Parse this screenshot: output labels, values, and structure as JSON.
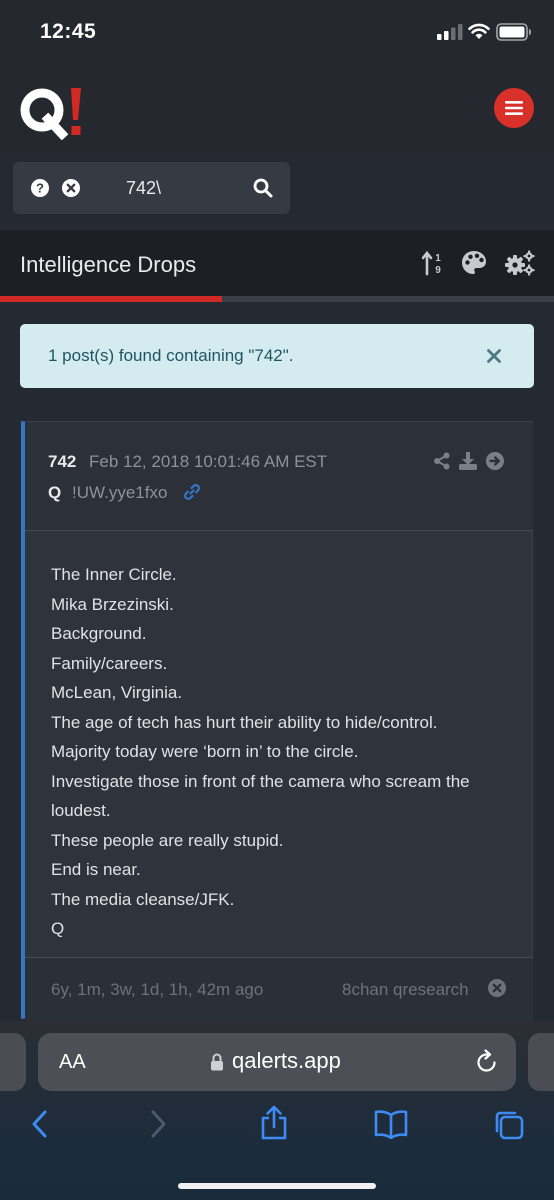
{
  "status_bar": {
    "time": "12:45"
  },
  "header": {
    "logo_text": "Q!"
  },
  "search": {
    "value": "742\\"
  },
  "toolbar": {
    "title": "Intelligence Drops"
  },
  "progress": {
    "fraction": 0.4
  },
  "alert": {
    "message": "1 post(s) found containing \"742\"."
  },
  "post": {
    "number": "742",
    "date": "Feb 12, 2018 10:01:46 AM EST",
    "author": "Q",
    "tripcode": "!UW.yye1fxo",
    "lines": [
      "The Inner Circle.",
      "Mika Brzezinski.",
      "Background.",
      "Family/careers.",
      "McLean, Virginia.",
      "The age of tech has hurt their ability to hide/control.",
      "Majority today were ‘born in’ to the circle.",
      "Investigate those in front of the camera who scream the",
      "loudest.",
      "These people are really stupid.",
      "End is near.",
      "The media cleanse/JFK.",
      "Q"
    ],
    "ago": "6y, 1m, 3w, 1d, 1h, 42m ago",
    "board": "8chan qresearch"
  },
  "browser": {
    "aa_label": "AA",
    "url": "qalerts.app"
  },
  "colors": {
    "accent_red": "#d12a25",
    "link_blue": "#3476c7"
  }
}
